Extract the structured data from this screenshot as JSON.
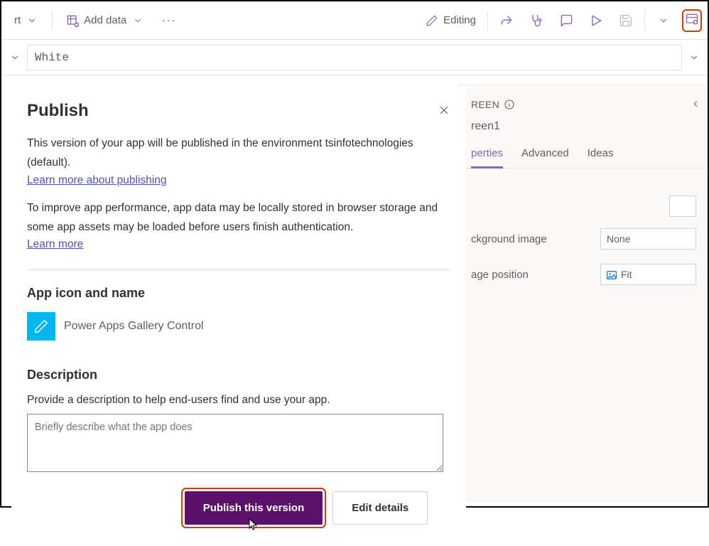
{
  "toolbar": {
    "insert_label": "rt",
    "add_data_label": "Add data",
    "editing_label": "Editing"
  },
  "formula": {
    "value": "White"
  },
  "props": {
    "header_label": "REEN",
    "screen_name": "reen1",
    "tabs": {
      "properties": "perties",
      "advanced": "Advanced",
      "ideas": "Ideas"
    },
    "bg_image_label": "ckground image",
    "bg_image_value": "None",
    "image_pos_label": "age position",
    "image_pos_value": "Fit"
  },
  "modal": {
    "title": "Publish",
    "body1a": "This version of your app will be published in the environment tsinfotechnologies",
    "body1b": "(default).",
    "learn_publishing": "Learn more about publishing",
    "body2a": "To improve app performance, app data may be locally stored in browser storage and",
    "body2b": "some app assets may be loaded before users finish authentication.",
    "learn_more": "Learn more",
    "app_icon_heading": "App icon and name",
    "app_name": "Power Apps Gallery Control",
    "desc_heading": "Description",
    "desc_helper": "Provide a description to help end-users find and use your app.",
    "desc_placeholder": "Briefly describe what the app does",
    "publish_btn": "Publish this version",
    "edit_btn": "Edit details"
  }
}
